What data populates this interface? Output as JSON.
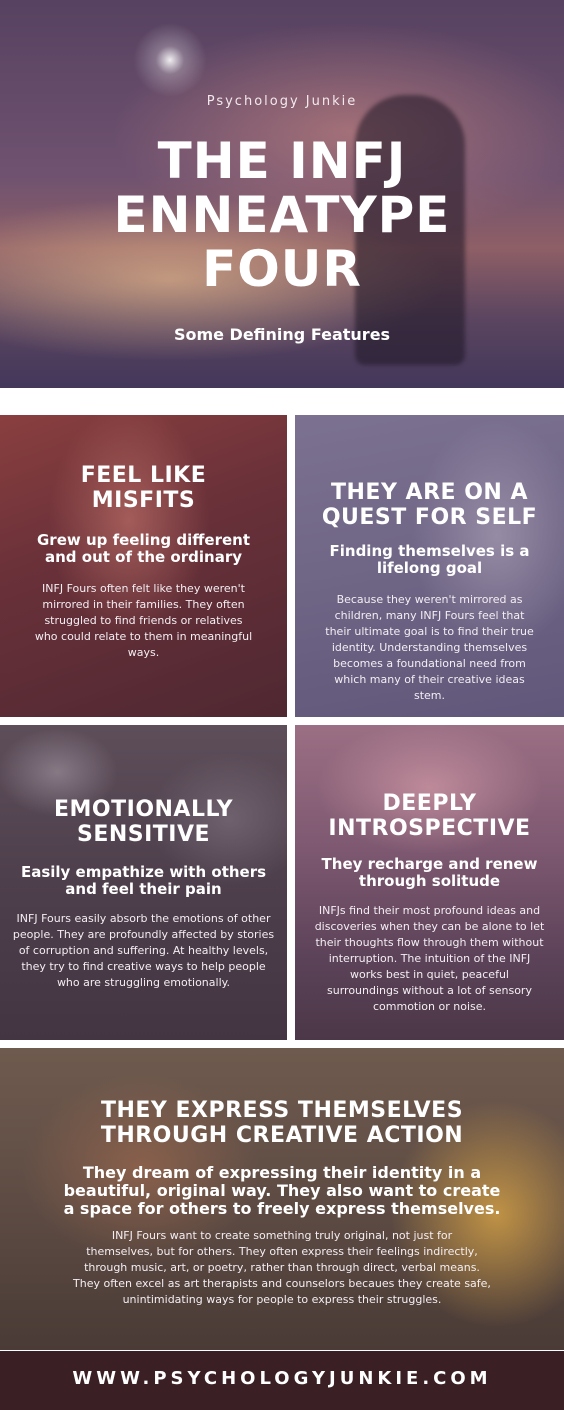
{
  "header": {
    "brand": "Psychology Junkie",
    "title_lines": [
      "THE INFJ",
      "ENNEATYPE",
      "FOUR"
    ],
    "subtitle": "Some Defining Features"
  },
  "panels": [
    {
      "heading_lines": [
        "FEEL LIKE",
        "MISFITS"
      ],
      "subheading_lines": [
        "Grew up feeling different",
        "and out of the ordinary"
      ],
      "body_lines": [
        "INFJ Fours often felt like they weren't",
        "mirrored in their families. They often",
        "struggled to find friends or relatives",
        "who could relate to them in meaningful",
        "ways."
      ]
    },
    {
      "heading_lines": [
        "THEY ARE ON A",
        "QUEST FOR SELF"
      ],
      "subheading_lines": [
        "Finding themselves is a",
        "lifelong goal"
      ],
      "body_lines": [
        "Because they weren't mirrored as",
        "children, many INFJ Fours feel that",
        "their ultimate goal is to find their true",
        "identity. Understanding themselves",
        "becomes a foundational need from",
        "which many of their creative ideas",
        "stem."
      ]
    },
    {
      "heading_lines": [
        "EMOTIONALLY",
        "SENSITIVE"
      ],
      "subheading_lines": [
        "Easily empathize with others",
        "and feel their pain"
      ],
      "body_lines": [
        "INFJ Fours easily absorb the emotions of other",
        "people. They are profoundly affected by stories",
        "of corruption and suffering. At healthy levels,",
        "they try to find creative ways to help people",
        "who are struggling emotionally."
      ]
    },
    {
      "heading_lines": [
        "DEEPLY",
        "INTROSPECTIVE"
      ],
      "subheading_lines": [
        "They recharge and renew",
        "through solitude"
      ],
      "body_lines": [
        "INFJs find their most profound ideas and",
        "discoveries when they can be alone to let",
        "their thoughts flow through them without",
        "interruption. The intuition of the INFJ",
        "works best in quiet, peaceful",
        "surroundings without a lot of sensory",
        "commotion or noise."
      ]
    },
    {
      "heading_lines": [
        "THEY EXPRESS THEMSELVES",
        "THROUGH CREATIVE ACTION"
      ],
      "subheading_lines": [
        "They dream of expressing their identity in a",
        "beautiful, original way. They also want to create",
        "a space for others to freely express themselves."
      ],
      "body_lines": [
        "INFJ Fours want to create something truly original, not just for",
        "themselves, but for others. They often express their feelings indirectly,",
        "through music, art, or poetry, rather than through direct, verbal means.",
        "They often excel as art therapists and counselors becaues they create safe,",
        "unintimidating ways for people to express their struggles."
      ]
    }
  ],
  "footer": {
    "url": "WWW.PSYCHOLOGYJUNKIE.COM"
  }
}
